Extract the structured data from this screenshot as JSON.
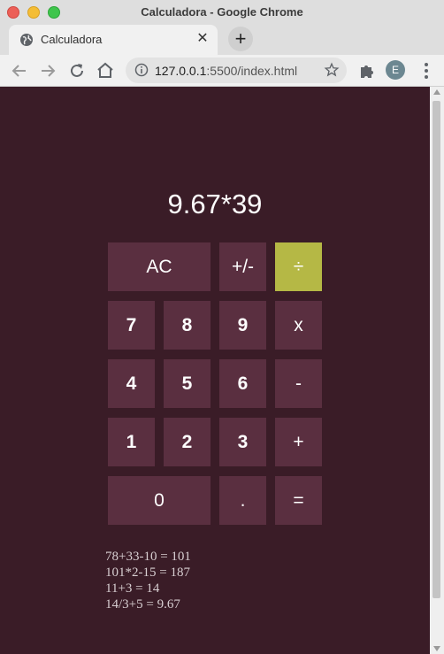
{
  "window": {
    "title": "Calculadora - Google Chrome"
  },
  "tab": {
    "title": "Calculadora",
    "close": "✕",
    "newtab": "+"
  },
  "toolbar": {
    "url_host": "127.0.0.1",
    "url_rest": ":5500/index.html",
    "profile_initial": "E"
  },
  "calculator": {
    "display": "9.67*39",
    "keys": {
      "ac": "AC",
      "sign": "+/-",
      "divide": "÷",
      "seven": "7",
      "eight": "8",
      "nine": "9",
      "multiply": "x",
      "four": "4",
      "five": "5",
      "six": "6",
      "minus": "-",
      "one": "1",
      "two": "2",
      "three": "3",
      "plus": "+",
      "zero": "0",
      "dot": ".",
      "equals": "="
    },
    "history": [
      "78+33-10 = 101",
      "101*2-15 = 187",
      "11+3 = 14",
      "14/3+5 = 9.67"
    ]
  },
  "colors": {
    "background": "#3a1c27",
    "key": "#5a2f40",
    "accent_key": "#b5b845"
  }
}
